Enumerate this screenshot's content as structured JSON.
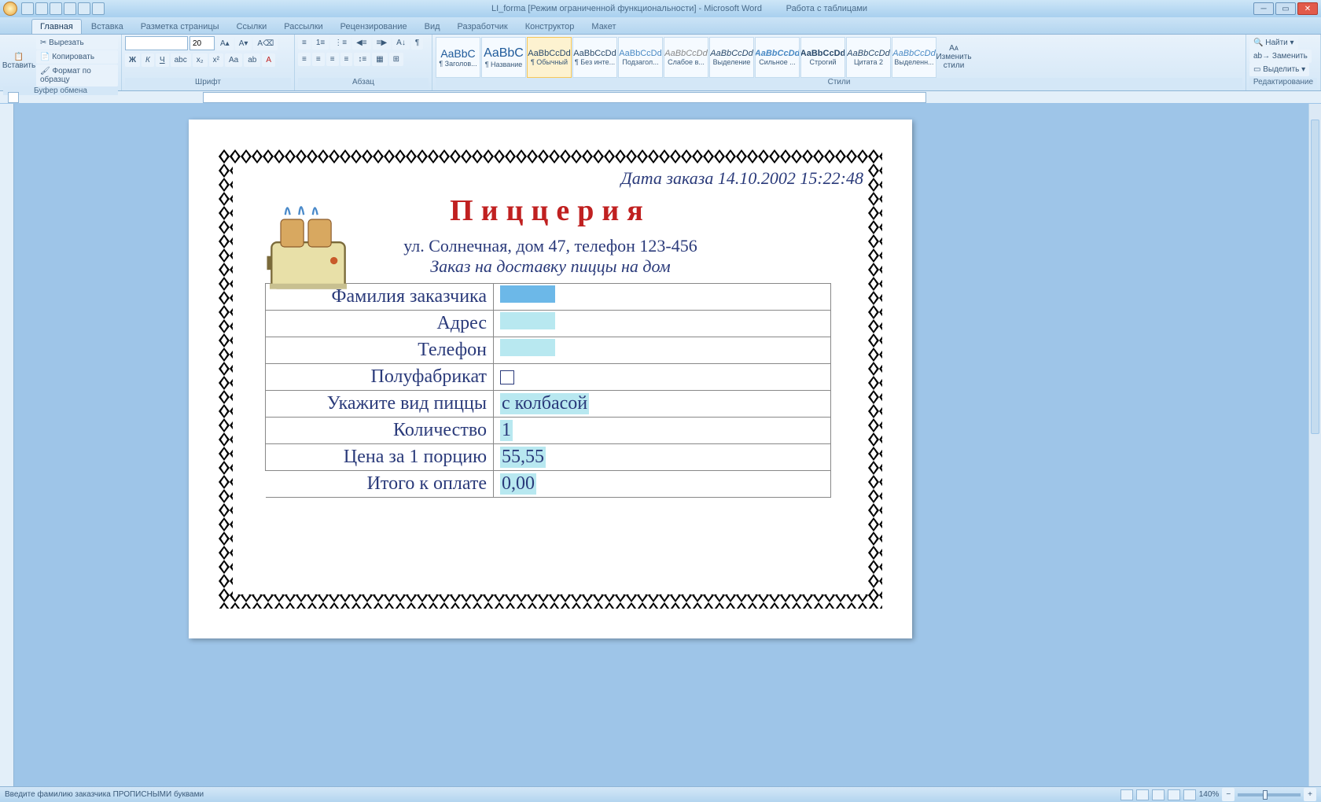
{
  "title": {
    "doc": "LI_forma [Режим ограниченной функциональности] - Microsoft Word",
    "ctx": "Работа с таблицами"
  },
  "tabs": [
    "Главная",
    "Вставка",
    "Разметка страницы",
    "Ссылки",
    "Рассылки",
    "Рецензирование",
    "Вид",
    "Разработчик",
    "Конструктор",
    "Макет"
  ],
  "clipboard": {
    "cut": "Вырезать",
    "copy": "Копировать",
    "formatp": "Формат по образцу",
    "paste": "Вставить",
    "group": "Буфер обмена"
  },
  "font": {
    "size": "20",
    "group": "Шрифт"
  },
  "para": {
    "group": "Абзац"
  },
  "styles": {
    "group": "Стили",
    "items": [
      {
        "p": "AaBbC",
        "n": "¶ Заголов..."
      },
      {
        "p": "AaBbC",
        "n": "¶ Название"
      },
      {
        "p": "AaBbCcDd",
        "n": "¶ Обычный"
      },
      {
        "p": "AaBbCcDd",
        "n": "¶ Без инте..."
      },
      {
        "p": "AaBbCcDd",
        "n": "Подзагол..."
      },
      {
        "p": "AaBbCcDd",
        "n": "Слабое в..."
      },
      {
        "p": "AaBbCcDd",
        "n": "Выделение"
      },
      {
        "p": "AaBbCcDd",
        "n": "Сильное ..."
      },
      {
        "p": "AaBbCcDd",
        "n": "Строгий"
      },
      {
        "p": "AaBbCcDd",
        "n": "Цитата 2"
      },
      {
        "p": "AaBbCcDd",
        "n": "Выделенн..."
      }
    ],
    "change": "Изменить\nстили"
  },
  "editing": {
    "find": "Найти",
    "replace": "Заменить",
    "select": "Выделить",
    "group": "Редактирование"
  },
  "doc": {
    "date": "Дата заказа 14.10.2002 15:22:48",
    "title": "Пиццерия",
    "addr": "ул. Солнечная, дом 47, телефон 123-456",
    "sub": "Заказ на доставку пиццы на дом",
    "rows": {
      "r1": "Фамилия заказчика",
      "v1": "",
      "r2": "Адрес",
      "v2": "",
      "r3": "Телефон",
      "v3": "",
      "r4": "Полуфабрикат",
      "r5": "Укажите вид пиццы",
      "v5": "с колбасой",
      "r6": "Количество",
      "v6": "1",
      "r7": "Цена за 1 порцию",
      "v7": "55,55",
      "r8": "Итого к оплате",
      "v8": "0,00"
    }
  },
  "status": {
    "msg": "Введите фамилию заказчика ПРОПИСНЫМИ буквами",
    "zoom": "140%"
  }
}
